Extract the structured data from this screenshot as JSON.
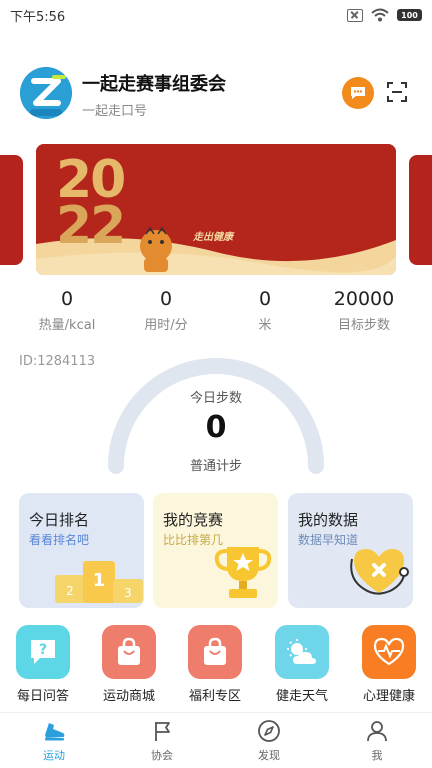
{
  "status_bar": {
    "time": "下午5:56",
    "battery": "100"
  },
  "header": {
    "org_name": "一起走赛事组委会",
    "org_sub": "一起走口号"
  },
  "banner": {
    "year_top": "20",
    "year_bottom": "22",
    "slogan": "走出健康"
  },
  "stats": [
    {
      "value": "0",
      "label": "热量/kcal"
    },
    {
      "value": "0",
      "label": "用时/分"
    },
    {
      "value": "0",
      "label": "米"
    },
    {
      "value": "20000",
      "label": "目标步数"
    }
  ],
  "user_id": "ID:1284113",
  "steps": {
    "label": "今日步数",
    "value": "0",
    "mode": "普通计步"
  },
  "cards": [
    {
      "title": "今日排名",
      "subtitle": "看看排名吧"
    },
    {
      "title": "我的竞赛",
      "subtitle": "比比排第几"
    },
    {
      "title": "我的数据",
      "subtitle": "数据早知道"
    }
  ],
  "podium_numbers": [
    "2",
    "1",
    "3"
  ],
  "features": [
    {
      "label": "每日问答",
      "icon": "question-chat-icon",
      "color": "#5dd6e6"
    },
    {
      "label": "运动商城",
      "icon": "shopping-bag-icon",
      "color": "#ef7d6c"
    },
    {
      "label": "福利专区",
      "icon": "shopping-bag-icon",
      "color": "#ef7d6c"
    },
    {
      "label": "健走天气",
      "icon": "weather-icon",
      "color": "#6fd5e8"
    },
    {
      "label": "心理健康",
      "icon": "heart-pulse-icon",
      "color": "#f97d22"
    }
  ],
  "tabs": [
    {
      "label": "运动",
      "icon": "shoe-icon",
      "active": true
    },
    {
      "label": "协会",
      "icon": "flag-icon",
      "active": false
    },
    {
      "label": "发现",
      "icon": "compass-icon",
      "active": false
    },
    {
      "label": "我",
      "icon": "person-icon",
      "active": false
    }
  ],
  "colors": {
    "accent": "#2ba0dc",
    "banner_red": "#b4261c",
    "orange": "#f28a1c"
  }
}
